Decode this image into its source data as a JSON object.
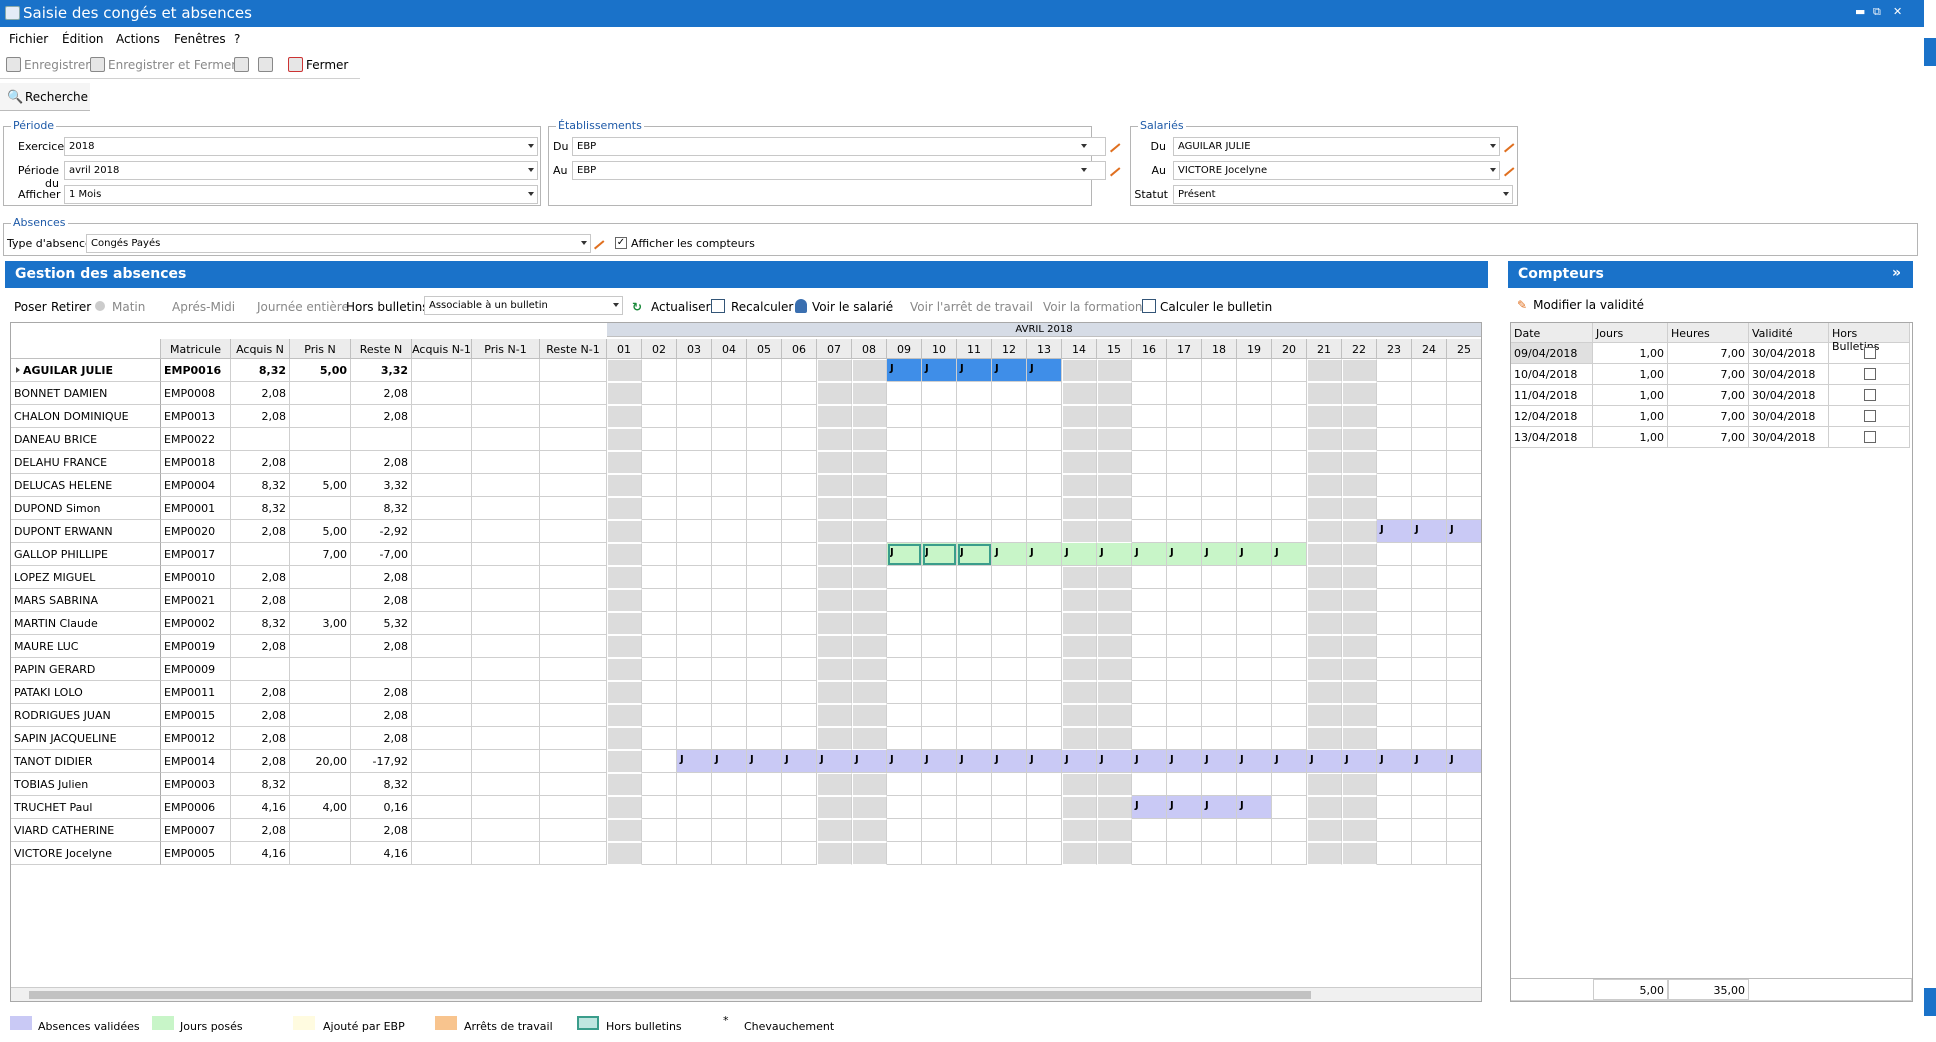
{
  "window": {
    "title": "Saisie des congés et absences",
    "min": "▬",
    "restore": "⧉",
    "close": "✕"
  },
  "menu": [
    "Fichier",
    "Édition",
    "Actions",
    "Fenêtres",
    "?"
  ],
  "toolbar": {
    "save": "Enregistrer",
    "save_close": "Enregistrer et Fermer",
    "close": "Fermer"
  },
  "search_label": "Recherche",
  "periode": {
    "legend": "Période",
    "exercice_label": "Exercice",
    "exercice": "2018",
    "periode_label": "Période du",
    "periode": "avril 2018",
    "afficher_label": "Afficher",
    "afficher": "1 Mois"
  },
  "etab": {
    "legend": "Établissements",
    "du_label": "Du",
    "du": "EBP",
    "au_label": "Au",
    "au": "EBP"
  },
  "salaries": {
    "legend": "Salariés",
    "du_label": "Du",
    "du": "AGUILAR JULIE",
    "au_label": "Au",
    "au": "VICTORE Jocelyne",
    "statut_label": "Statut",
    "statut": "Présent"
  },
  "absences": {
    "legend": "Absences",
    "type_label": "Type d'absence",
    "type": "Congés Payés",
    "show_counters": "Afficher les compteurs"
  },
  "gestion": {
    "title": "Gestion des absences",
    "poser": "Poser",
    "retirer": "Retirer",
    "matin": "Matin",
    "apres_midi": "Aprés-Midi",
    "journee": "Journée entière",
    "hors_label": "Hors bulletins",
    "hors_value": "Associable à un bulletin",
    "actualiser": "Actualiser",
    "recalculer": "Recalculer",
    "voir_salarie": "Voir le salarié",
    "voir_arret": "Voir l'arrêt de travail",
    "voir_formation": "Voir la formation",
    "calculer": "Calculer le bulletin"
  },
  "grid": {
    "month": "AVRIL 2018",
    "columns": [
      "Matricule",
      "Acquis N",
      "Pris N",
      "Reste N",
      "Acquis N-1",
      "Pris N-1",
      "Reste N-1"
    ],
    "days": [
      "01",
      "02",
      "03",
      "04",
      "05",
      "06",
      "07",
      "08",
      "09",
      "10",
      "11",
      "12",
      "13",
      "14",
      "15",
      "16",
      "17",
      "18",
      "19",
      "20",
      "21",
      "22",
      "23",
      "24",
      "25"
    ],
    "weekend_days": [
      "01",
      "07",
      "08",
      "14",
      "15",
      "21",
      "22"
    ],
    "rows": [
      {
        "name": "AGUILAR JULIE",
        "mat": "EMP0016",
        "acq": "8,32",
        "pris": "5,00",
        "reste": "3,32",
        "bold": true,
        "abs": [
          {
            "d": [
              "09",
              "10",
              "11",
              "12",
              "13"
            ],
            "type": "sel"
          }
        ]
      },
      {
        "name": "BONNET DAMIEN",
        "mat": "EMP0008",
        "acq": "2,08",
        "pris": "",
        "reste": "2,08"
      },
      {
        "name": "CHALON DOMINIQUE",
        "mat": "EMP0013",
        "acq": "2,08",
        "pris": "",
        "reste": "2,08"
      },
      {
        "name": "DANEAU BRICE",
        "mat": "EMP0022",
        "acq": "",
        "pris": "",
        "reste": ""
      },
      {
        "name": "DELAHU FRANCE",
        "mat": "EMP0018",
        "acq": "2,08",
        "pris": "",
        "reste": "2,08"
      },
      {
        "name": "DELUCAS HELENE",
        "mat": "EMP0004",
        "acq": "8,32",
        "pris": "5,00",
        "reste": "3,32"
      },
      {
        "name": "DUPOND Simon",
        "mat": "EMP0001",
        "acq": "8,32",
        "pris": "",
        "reste": "8,32"
      },
      {
        "name": "DUPONT ERWANN",
        "mat": "EMP0020",
        "acq": "2,08",
        "pris": "5,00",
        "reste": "-2,92",
        "abs": [
          {
            "d": [
              "23",
              "24",
              "25"
            ],
            "type": "val"
          }
        ]
      },
      {
        "name": "GALLOP PHILLIPE",
        "mat": "EMP0017",
        "acq": "",
        "pris": "7,00",
        "reste": "-7,00",
        "abs": [
          {
            "d": [
              "09",
              "10",
              "11"
            ],
            "type": "hors"
          },
          {
            "d": [
              "12",
              "13",
              "14",
              "15",
              "16",
              "17",
              "18",
              "19",
              "20"
            ],
            "type": "pose"
          }
        ]
      },
      {
        "name": "LOPEZ MIGUEL",
        "mat": "EMP0010",
        "acq": "2,08",
        "pris": "",
        "reste": "2,08"
      },
      {
        "name": "MARS SABRINA",
        "mat": "EMP0021",
        "acq": "2,08",
        "pris": "",
        "reste": "2,08"
      },
      {
        "name": "MARTIN Claude",
        "mat": "EMP0002",
        "acq": "8,32",
        "pris": "3,00",
        "reste": "5,32"
      },
      {
        "name": "MAURE LUC",
        "mat": "EMP0019",
        "acq": "2,08",
        "pris": "",
        "reste": "2,08"
      },
      {
        "name": "PAPIN GERARD",
        "mat": "EMP0009",
        "acq": "",
        "pris": "",
        "reste": ""
      },
      {
        "name": "PATAKI LOLO",
        "mat": "EMP0011",
        "acq": "2,08",
        "pris": "",
        "reste": "2,08"
      },
      {
        "name": "RODRIGUES JUAN",
        "mat": "EMP0015",
        "acq": "2,08",
        "pris": "",
        "reste": "2,08"
      },
      {
        "name": "SAPIN JACQUELINE",
        "mat": "EMP0012",
        "acq": "2,08",
        "pris": "",
        "reste": "2,08"
      },
      {
        "name": "TANOT DIDIER",
        "mat": "EMP0014",
        "acq": "2,08",
        "pris": "20,00",
        "reste": "-17,92",
        "abs": [
          {
            "d": [
              "03",
              "04",
              "05",
              "06",
              "07",
              "08",
              "09",
              "10",
              "11",
              "12",
              "13",
              "14",
              "15",
              "16",
              "17",
              "18",
              "19",
              "20",
              "21",
              "22",
              "23",
              "24",
              "25"
            ],
            "type": "val"
          }
        ]
      },
      {
        "name": "TOBIAS Julien",
        "mat": "EMP0003",
        "acq": "8,32",
        "pris": "",
        "reste": "8,32"
      },
      {
        "name": "TRUCHET Paul",
        "mat": "EMP0006",
        "acq": "4,16",
        "pris": "4,00",
        "reste": "0,16",
        "abs": [
          {
            "d": [
              "16",
              "17",
              "18",
              "19"
            ],
            "type": "val"
          }
        ]
      },
      {
        "name": "VIARD CATHERINE",
        "mat": "EMP0007",
        "acq": "2,08",
        "pris": "",
        "reste": "2,08"
      },
      {
        "name": "VICTORE Jocelyne",
        "mat": "EMP0005",
        "acq": "4,16",
        "pris": "",
        "reste": "4,16"
      }
    ],
    "abs_letter": "J"
  },
  "compteurs": {
    "title": "Compteurs",
    "modifier": "Modifier la validité",
    "columns": [
      "Date",
      "Jours",
      "Heures",
      "Validité",
      "Hors Bulletins"
    ],
    "rows": [
      {
        "date": "09/04/2018",
        "jours": "1,00",
        "heures": "7,00",
        "validite": "30/04/2018"
      },
      {
        "date": "10/04/2018",
        "jours": "1,00",
        "heures": "7,00",
        "validite": "30/04/2018"
      },
      {
        "date": "11/04/2018",
        "jours": "1,00",
        "heures": "7,00",
        "validite": "30/04/2018"
      },
      {
        "date": "12/04/2018",
        "jours": "1,00",
        "heures": "7,00",
        "validite": "30/04/2018"
      },
      {
        "date": "13/04/2018",
        "jours": "1,00",
        "heures": "7,00",
        "validite": "30/04/2018"
      }
    ],
    "total_jours": "5,00",
    "total_heures": "35,00"
  },
  "legend": [
    {
      "label": "Absences validées",
      "color": "#c9c9f5"
    },
    {
      "label": "Jours posés",
      "color": "#c8f5c8"
    },
    {
      "label": "Ajouté par EBP",
      "color": "#fffbe0"
    },
    {
      "label": "Arrêts de travail",
      "color": "#f8c48e"
    },
    {
      "label": "Hors bulletins",
      "color": "#bfe6e0"
    },
    {
      "label": "Chevauchement",
      "symbol": "*"
    }
  ]
}
